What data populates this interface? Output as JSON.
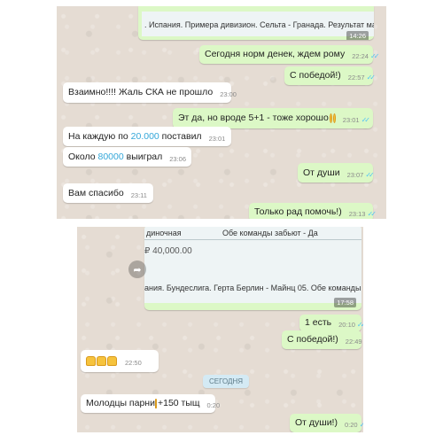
{
  "top_chat": {
    "shared_card": {
      "text": ". Испания. Примера дивизион. Сельта - Гранада. Результат матча : Сельт",
      "time": "14:26"
    },
    "messages": [
      {
        "text": "Сегодня норм денек, ждем рому",
        "time": "22:24"
      },
      {
        "text": "С победой!)",
        "time": "22:57"
      },
      {
        "text": "Взаимно!!!! Жаль СКА не прошло",
        "time": "23:00"
      },
      {
        "text": "Эт да, но вроде 5+1 - тоже хорошо",
        "time": "23:01"
      },
      {
        "text_before": "На каждую по ",
        "amount": "20.000",
        "text_after": " поставил",
        "time": "23:01"
      },
      {
        "text_before": "Около ",
        "amount": "80000",
        "text_after": " выиграл",
        "time": "23:06"
      },
      {
        "text": "От души",
        "time": "23:07"
      },
      {
        "text": "Вам спасибо",
        "time": "23:11"
      },
      {
        "text": "Только рад помочь!)",
        "time": "23:13"
      }
    ]
  },
  "bottom_chat": {
    "media_card": {
      "type_label": "диночная",
      "bet_label": "Обе команды забьют - Да",
      "amount": "₽ 40,000.00",
      "caption": "ания. Бундеслига. Герта Берлин - Майнц 05. Обе команды за",
      "time": "17:58"
    },
    "messages": [
      {
        "text": "1 есть",
        "time": "20:10"
      },
      {
        "text": "С победой!)",
        "time": "22:49"
      },
      {
        "time": "22:50"
      },
      {
        "text": "Молодцы парни",
        "suffix": "+150 тыщ",
        "time": "0:20"
      },
      {
        "text": "От души!)",
        "time": "0:20"
      }
    ],
    "date_divider": "СЕГОДНЯ"
  },
  "colors": {
    "wallpaper": "#e5dcd3",
    "outgoing_bubble": "#dcf8c6",
    "incoming_bubble": "#ffffff",
    "read_ticks": "#4fc3f7",
    "amount_highlight": "#34a7d9"
  }
}
